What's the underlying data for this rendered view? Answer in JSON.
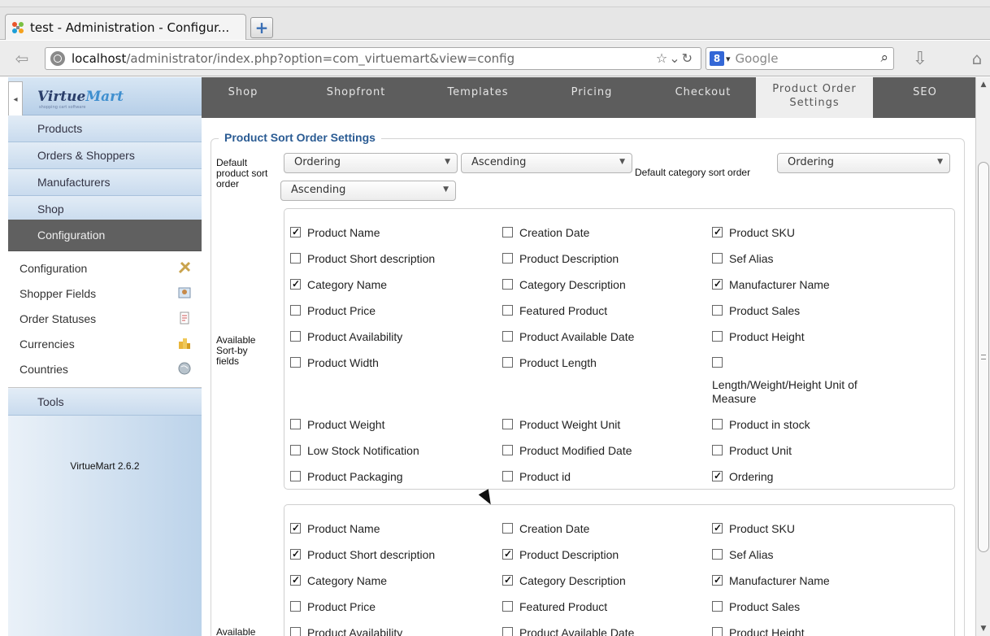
{
  "browser": {
    "tab_title": "test - Administration - Configur...",
    "url_host": "localhost",
    "url_path": "/administrator/index.php?option=com_virtuemart&view=config",
    "search_placeholder": "Google",
    "search_engine_letter": "8",
    "icons": [
      "back-arrow-icon",
      "globe-icon",
      "star-icon",
      "reload-icon",
      "search-icon",
      "download-icon",
      "home-icon",
      "new-tab-icon",
      "joomla-favicon"
    ]
  },
  "sidebar": {
    "logo": {
      "part1": "Virtue",
      "part2": "Mart",
      "tagline": "shopping cart software"
    },
    "menu": [
      {
        "label": "Products"
      },
      {
        "label": "Orders & Shoppers"
      },
      {
        "label": "Manufacturers"
      },
      {
        "label": "Shop"
      },
      {
        "label": "Configuration",
        "active": true
      }
    ],
    "submenu": [
      {
        "label": "Configuration",
        "icon": "tools-icon"
      },
      {
        "label": "Shopper Fields",
        "icon": "user-fields-icon"
      },
      {
        "label": "Order Statuses",
        "icon": "document-icon"
      },
      {
        "label": "Currencies",
        "icon": "coins-icon"
      },
      {
        "label": "Countries",
        "icon": "globe-icon"
      }
    ],
    "tools_label": "Tools",
    "version": "VirtueMart 2.6.2"
  },
  "tabs": [
    {
      "label": "Shop"
    },
    {
      "label": "Shopfront"
    },
    {
      "label": "Templates"
    },
    {
      "label": "Pricing"
    },
    {
      "label": "Checkout"
    },
    {
      "label": "Product Order Settings",
      "active": true
    },
    {
      "label": "SEO"
    }
  ],
  "sort_settings": {
    "legend": "Product Sort Order Settings",
    "default_product_label": "Default product sort order",
    "default_product_field": "Ordering",
    "default_product_direction": "Ascending",
    "default_category_label": "Default category sort order",
    "default_category_field": "Ordering",
    "default_category_direction": "Ascending",
    "available_sortby_label": "Available Sort-by fields",
    "available_label_2": "Available"
  },
  "sortby_fields": [
    {
      "label": "Product Name",
      "checked": true
    },
    {
      "label": "Creation Date",
      "checked": false
    },
    {
      "label": "Product SKU",
      "checked": true
    },
    {
      "label": "Product Short description",
      "checked": false
    },
    {
      "label": "Product Description",
      "checked": false
    },
    {
      "label": "Sef Alias",
      "checked": false
    },
    {
      "label": "Category Name",
      "checked": true
    },
    {
      "label": "Category Description",
      "checked": false
    },
    {
      "label": "Manufacturer Name",
      "checked": true
    },
    {
      "label": "Product Price",
      "checked": false
    },
    {
      "label": "Featured Product",
      "checked": false
    },
    {
      "label": "Product Sales",
      "checked": false
    },
    {
      "label": "Product Availability",
      "checked": false
    },
    {
      "label": "Product Available Date",
      "checked": false
    },
    {
      "label": "Product Height",
      "checked": false
    },
    {
      "label": "Product Width",
      "checked": false
    },
    {
      "label": "Product Length",
      "checked": false
    },
    {
      "label": "Length/Weight/Height Unit of Measure",
      "checked": false
    },
    {
      "label": "Product Weight",
      "checked": false
    },
    {
      "label": "Product Weight Unit",
      "checked": false
    },
    {
      "label": "Product in stock",
      "checked": false
    },
    {
      "label": "Low Stock Notification",
      "checked": false
    },
    {
      "label": "Product Modified Date",
      "checked": false
    },
    {
      "label": "Product Unit",
      "checked": false
    },
    {
      "label": "Product Packaging",
      "checked": false
    },
    {
      "label": "Product id",
      "checked": false
    },
    {
      "label": "Ordering",
      "checked": true
    }
  ],
  "search_fields": [
    {
      "label": "Product Name",
      "checked": true
    },
    {
      "label": "Creation Date",
      "checked": false
    },
    {
      "label": "Product SKU",
      "checked": true
    },
    {
      "label": "Product Short description",
      "checked": true
    },
    {
      "label": "Product Description",
      "checked": true
    },
    {
      "label": "Sef Alias",
      "checked": false
    },
    {
      "label": "Category Name",
      "checked": true
    },
    {
      "label": "Category Description",
      "checked": true
    },
    {
      "label": "Manufacturer Name",
      "checked": true
    },
    {
      "label": "Product Price",
      "checked": false
    },
    {
      "label": "Featured Product",
      "checked": false
    },
    {
      "label": "Product Sales",
      "checked": false
    },
    {
      "label": "Product Availability",
      "checked": false
    },
    {
      "label": "Product Available Date",
      "checked": false
    },
    {
      "label": "Product Height",
      "checked": false
    }
  ]
}
